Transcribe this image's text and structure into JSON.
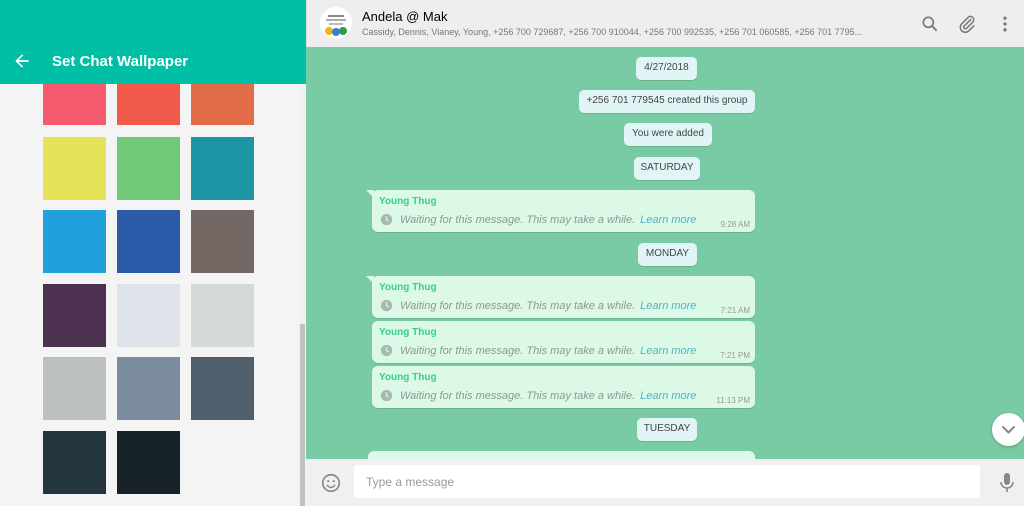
{
  "left_panel": {
    "title": "Set Chat Wallpaper",
    "swatches": [
      "#f45b6e",
      "#f15a4a",
      "#e06c4a",
      "#e5e35a",
      "#72c97a",
      "#1e95a4",
      "#22a0dc",
      "#2b5ba8",
      "#736763",
      "#4c3250",
      "#dde3e8",
      "#d5d9d8",
      "#bdc0c1",
      "#7a8c9e",
      "#4f5f6b",
      "#24363d",
      "#162227"
    ]
  },
  "chat": {
    "group_name": "Andela @ Mak",
    "members": "Cassidy, Dennis, Vianey, Young, +256 700 729687, +256 700 910044, +256 700 992535, +256 701 060585, +256 701 7795...",
    "system_messages": {
      "date": "4/27/2018",
      "created": "+256 701 779545 created this group",
      "added": "You were added",
      "saturday": "SATURDAY",
      "monday": "MONDAY",
      "tuesday": "TUESDAY"
    },
    "messages": [
      {
        "sender": "Young Thug",
        "text": "Waiting for this message. This may take a while.",
        "learn": "Learn more",
        "time": "9:28 AM"
      },
      {
        "sender": "Young Thug",
        "text": "Waiting for this message. This may take a while.",
        "learn": "Learn more",
        "time": "7:21 AM"
      },
      {
        "sender": "Young Thug",
        "text": "Waiting for this message. This may take a while.",
        "learn": "Learn more",
        "time": "7:21 PM"
      },
      {
        "sender": "Young Thug",
        "text": "Waiting for this message. This may take a while.",
        "learn": "Learn more",
        "time": "11:13 PM"
      }
    ]
  },
  "composer": {
    "placeholder": "Type a message"
  },
  "icons": {
    "back": "arrow-left-icon",
    "search": "search-icon",
    "attach": "paperclip-icon",
    "menu": "more-vertical-icon",
    "scroll": "chevron-down-icon",
    "emoji": "smiley-icon",
    "mic": "microphone-icon",
    "clock": "clock-icon"
  },
  "colors": {
    "accent": "#00bfa5",
    "wallpaper": "#79cba5",
    "bubble": "#dcf8e7",
    "sender": "#35cd96",
    "system_bubble": "#e1f5f7"
  }
}
